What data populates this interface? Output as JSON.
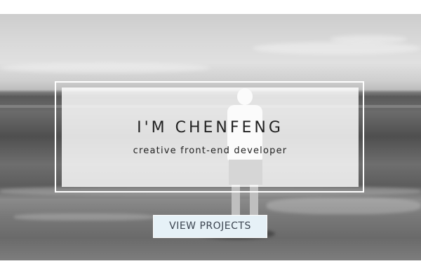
{
  "hero": {
    "title": "I'M CHENFENG",
    "subtitle": "creative front-end developer",
    "cta_label": "VIEW PROJECTS"
  },
  "colors": {
    "button_bg": "#e6f1f7",
    "button_text": "#3b4450",
    "heading_text": "#222222",
    "frame": "#ffffff"
  }
}
